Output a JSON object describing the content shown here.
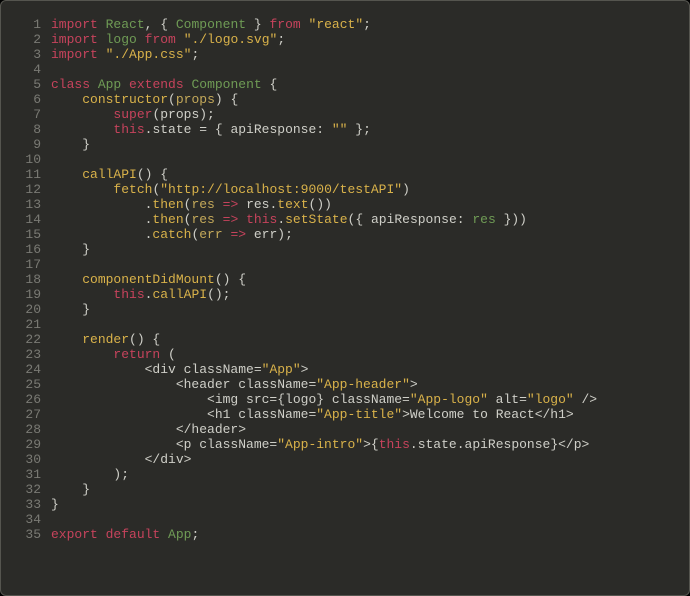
{
  "language": "javascript",
  "filename": "App.js",
  "theme": {
    "bg": "#2b2b28",
    "gutter": "#7a7a74",
    "fg": "#cfcfc8",
    "kw": "#c6435c",
    "id": "#6f9b55",
    "str": "#d9b24a"
  },
  "lines": [
    {
      "n": 1,
      "tokens": [
        [
          "kw",
          "import"
        ],
        [
          "pl",
          " "
        ],
        [
          "id",
          "React"
        ],
        [
          "pl",
          ", { "
        ],
        [
          "id",
          "Component"
        ],
        [
          "pl",
          " } "
        ],
        [
          "kw",
          "from"
        ],
        [
          "pl",
          " "
        ],
        [
          "str",
          "\"react\""
        ],
        [
          "pl",
          ";"
        ]
      ]
    },
    {
      "n": 2,
      "tokens": [
        [
          "kw",
          "import"
        ],
        [
          "pl",
          " "
        ],
        [
          "id",
          "logo"
        ],
        [
          "pl",
          " "
        ],
        [
          "kw",
          "from"
        ],
        [
          "pl",
          " "
        ],
        [
          "str",
          "\"./logo.svg\""
        ],
        [
          "pl",
          ";"
        ]
      ]
    },
    {
      "n": 3,
      "tokens": [
        [
          "kw",
          "import"
        ],
        [
          "pl",
          " "
        ],
        [
          "str",
          "\"./App.css\""
        ],
        [
          "pl",
          ";"
        ]
      ]
    },
    {
      "n": 4,
      "tokens": [
        [
          "pl",
          ""
        ]
      ]
    },
    {
      "n": 5,
      "tokens": [
        [
          "kw",
          "class"
        ],
        [
          "pl",
          " "
        ],
        [
          "id",
          "App"
        ],
        [
          "pl",
          " "
        ],
        [
          "kw",
          "extends"
        ],
        [
          "pl",
          " "
        ],
        [
          "id",
          "Component"
        ],
        [
          "pl",
          " {"
        ]
      ]
    },
    {
      "n": 6,
      "tokens": [
        [
          "pl",
          "    "
        ],
        [
          "yl",
          "constructor"
        ],
        [
          "pl",
          "("
        ],
        [
          "par",
          "props"
        ],
        [
          "pl",
          ") {"
        ]
      ]
    },
    {
      "n": 7,
      "tokens": [
        [
          "pl",
          "        "
        ],
        [
          "kw",
          "super"
        ],
        [
          "pl",
          "(props);"
        ]
      ]
    },
    {
      "n": 8,
      "tokens": [
        [
          "pl",
          "        "
        ],
        [
          "kw",
          "this"
        ],
        [
          "pl",
          ".state = { apiResponse: "
        ],
        [
          "str",
          "\"\""
        ],
        [
          "pl",
          " };"
        ]
      ]
    },
    {
      "n": 9,
      "tokens": [
        [
          "pl",
          "    }"
        ]
      ]
    },
    {
      "n": 10,
      "tokens": [
        [
          "pl",
          ""
        ]
      ]
    },
    {
      "n": 11,
      "tokens": [
        [
          "pl",
          "    "
        ],
        [
          "yl",
          "callAPI"
        ],
        [
          "pl",
          "() {"
        ]
      ]
    },
    {
      "n": 12,
      "tokens": [
        [
          "pl",
          "        "
        ],
        [
          "yl",
          "fetch"
        ],
        [
          "pl",
          "("
        ],
        [
          "str",
          "\"http://localhost:9000/testAPI\""
        ],
        [
          "pl",
          ")"
        ]
      ]
    },
    {
      "n": 13,
      "tokens": [
        [
          "pl",
          "            ."
        ],
        [
          "yl",
          "then"
        ],
        [
          "pl",
          "("
        ],
        [
          "par",
          "res"
        ],
        [
          "pl",
          " "
        ],
        [
          "kw",
          "=>"
        ],
        [
          "pl",
          " res."
        ],
        [
          "yl",
          "text"
        ],
        [
          "pl",
          "())"
        ]
      ]
    },
    {
      "n": 14,
      "tokens": [
        [
          "pl",
          "            ."
        ],
        [
          "yl",
          "then"
        ],
        [
          "pl",
          "("
        ],
        [
          "par",
          "res"
        ],
        [
          "pl",
          " "
        ],
        [
          "kw",
          "=>"
        ],
        [
          "pl",
          " "
        ],
        [
          "kw",
          "this"
        ],
        [
          "pl",
          "."
        ],
        [
          "yl",
          "setState"
        ],
        [
          "pl",
          "({ apiResponse: "
        ],
        [
          "id",
          "res"
        ],
        [
          "pl",
          " }))"
        ]
      ]
    },
    {
      "n": 15,
      "tokens": [
        [
          "pl",
          "            ."
        ],
        [
          "yl",
          "catch"
        ],
        [
          "pl",
          "("
        ],
        [
          "par",
          "err"
        ],
        [
          "pl",
          " "
        ],
        [
          "kw",
          "=>"
        ],
        [
          "pl",
          " err);"
        ]
      ]
    },
    {
      "n": 16,
      "tokens": [
        [
          "pl",
          "    }"
        ]
      ]
    },
    {
      "n": 17,
      "tokens": [
        [
          "pl",
          ""
        ]
      ]
    },
    {
      "n": 18,
      "tokens": [
        [
          "pl",
          "    "
        ],
        [
          "yl",
          "componentDidMount"
        ],
        [
          "pl",
          "() {"
        ]
      ]
    },
    {
      "n": 19,
      "tokens": [
        [
          "pl",
          "        "
        ],
        [
          "kw",
          "this"
        ],
        [
          "pl",
          "."
        ],
        [
          "yl",
          "callAPI"
        ],
        [
          "pl",
          "();"
        ]
      ]
    },
    {
      "n": 20,
      "tokens": [
        [
          "pl",
          "    }"
        ]
      ]
    },
    {
      "n": 21,
      "tokens": [
        [
          "pl",
          ""
        ]
      ]
    },
    {
      "n": 22,
      "tokens": [
        [
          "pl",
          "    "
        ],
        [
          "yl",
          "render"
        ],
        [
          "pl",
          "() {"
        ]
      ]
    },
    {
      "n": 23,
      "tokens": [
        [
          "pl",
          "        "
        ],
        [
          "kw",
          "return"
        ],
        [
          "pl",
          " ("
        ]
      ]
    },
    {
      "n": 24,
      "tokens": [
        [
          "pl",
          "            <div className="
        ],
        [
          "str",
          "\"App\""
        ],
        [
          "pl",
          ">"
        ]
      ]
    },
    {
      "n": 25,
      "tokens": [
        [
          "pl",
          "                <header className="
        ],
        [
          "str",
          "\"App-header\""
        ],
        [
          "pl",
          ">"
        ]
      ]
    },
    {
      "n": 26,
      "tokens": [
        [
          "pl",
          "                    <img src={logo} className="
        ],
        [
          "str",
          "\"App-logo\""
        ],
        [
          "pl",
          " alt="
        ],
        [
          "str",
          "\"logo\""
        ],
        [
          "pl",
          " />"
        ]
      ]
    },
    {
      "n": 27,
      "tokens": [
        [
          "pl",
          "                    <h1 className="
        ],
        [
          "str",
          "\"App-title\""
        ],
        [
          "pl",
          ">Welcome to React</h1>"
        ]
      ]
    },
    {
      "n": 28,
      "tokens": [
        [
          "pl",
          "                </header>"
        ]
      ]
    },
    {
      "n": 29,
      "tokens": [
        [
          "pl",
          "                <p className="
        ],
        [
          "str",
          "\"App-intro\""
        ],
        [
          "pl",
          ">{"
        ],
        [
          "kw",
          "this"
        ],
        [
          "pl",
          ".state.apiResponse}</p>"
        ]
      ]
    },
    {
      "n": 30,
      "tokens": [
        [
          "pl",
          "            </div>"
        ]
      ]
    },
    {
      "n": 31,
      "tokens": [
        [
          "pl",
          "        );"
        ]
      ]
    },
    {
      "n": 32,
      "tokens": [
        [
          "pl",
          "    }"
        ]
      ]
    },
    {
      "n": 33,
      "tokens": [
        [
          "pl",
          "}"
        ]
      ]
    },
    {
      "n": 34,
      "tokens": [
        [
          "pl",
          ""
        ]
      ]
    },
    {
      "n": 35,
      "tokens": [
        [
          "kw",
          "export"
        ],
        [
          "pl",
          " "
        ],
        [
          "kw",
          "default"
        ],
        [
          "pl",
          " "
        ],
        [
          "id",
          "App"
        ],
        [
          "pl",
          ";"
        ]
      ]
    }
  ]
}
